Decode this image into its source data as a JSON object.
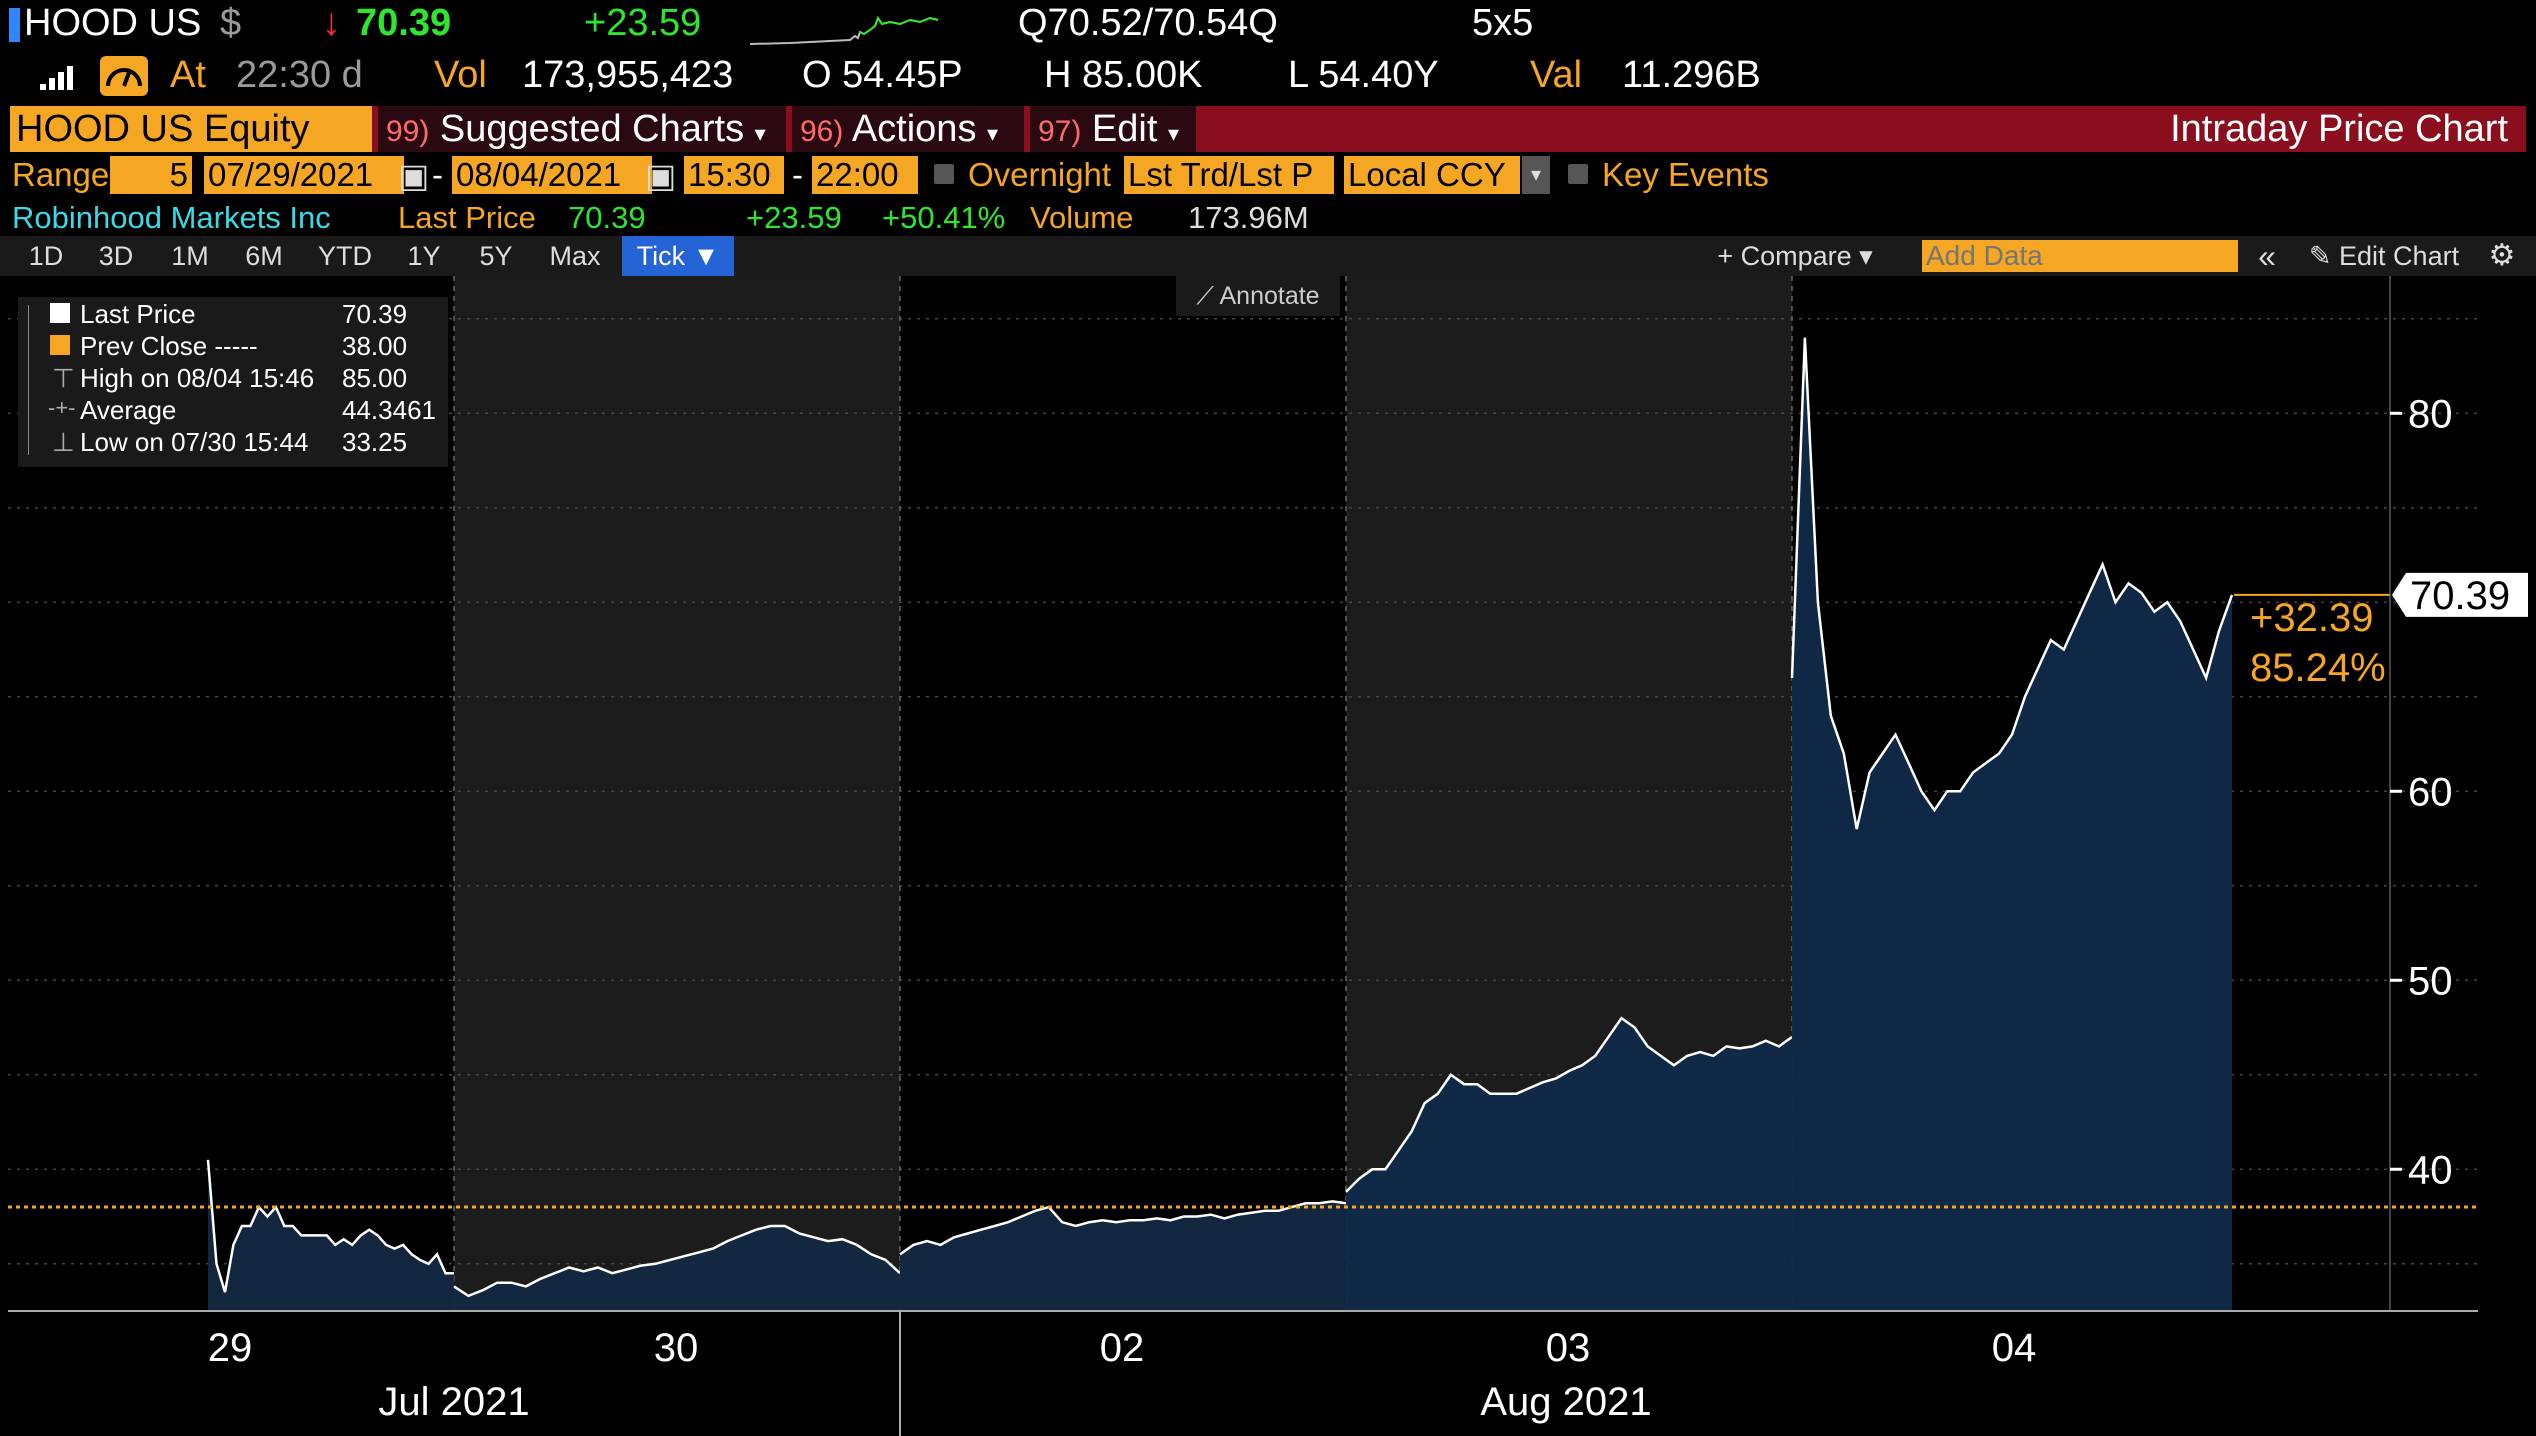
{
  "header": {
    "ticker": "HOOD US",
    "currency": "$",
    "arrow": "↓",
    "last": "70.39",
    "change": "+23.59",
    "quote": "Q70.52/70.54Q",
    "size": "5x5",
    "time_label": "At",
    "time": "22:30 d",
    "vol_label": "Vol",
    "vol": "173,955,423",
    "open": "O 54.45P",
    "high": "H 85.00K",
    "low": "L 54.40Y",
    "val_label": "Val",
    "val": "11.296B"
  },
  "menu": {
    "security": "HOOD US Equity",
    "suggested_num": "99)",
    "suggested": "Suggested Charts",
    "actions_num": "96)",
    "actions": "Actions",
    "edit_num": "97)",
    "edit": "Edit",
    "title": "Intraday Price Chart"
  },
  "range": {
    "label": "Range",
    "days": "5",
    "start": "07/29/2021",
    "end": "08/04/2021",
    "time_start": "15:30",
    "time_end": "22:00",
    "overnight": "Overnight",
    "lst_trd": "Lst Trd/Lst P",
    "ccy": "Local CCY",
    "key_events": "Key Events"
  },
  "info": {
    "name": "Robinhood Markets Inc",
    "last_label": "Last Price",
    "last": "70.39",
    "change": "+23.59",
    "pct": "+50.41%",
    "volume_label": "Volume",
    "volume": "173.96M"
  },
  "toolbar": {
    "periods": [
      "1D",
      "3D",
      "1M",
      "6M",
      "YTD",
      "1Y",
      "5Y",
      "Max"
    ],
    "tick": "Tick ▼",
    "compare": "+ Compare ▾",
    "add_data_placeholder": "Add Data",
    "collapse": "«",
    "edit_chart": "✎ Edit Chart",
    "settings_icon": "gear-icon",
    "annotate": "⟋ Annotate"
  },
  "chart_data": {
    "type": "area",
    "title": "Intraday Price Chart",
    "legend": [
      {
        "name": "Last Price",
        "value": "70.39"
      },
      {
        "name": "Prev Close -----",
        "value": "38.00"
      },
      {
        "name": "High on 08/04 15:46",
        "value": "85.00"
      },
      {
        "name": "Average",
        "value": "44.3461"
      },
      {
        "name": "Low on 07/30 15:44",
        "value": "33.25"
      }
    ],
    "ylim": [
      32.5,
      87
    ],
    "yticks": [
      40,
      50,
      60,
      80
    ],
    "ytick_labels": [
      "40",
      "50",
      "60",
      "80"
    ],
    "days": [
      "29",
      "30",
      "02",
      "03",
      "04"
    ],
    "months": [
      "Jul 2021",
      "Aug 2021"
    ],
    "prev_close": 38.0,
    "last_price": 70.39,
    "last_label": "70.39",
    "change_abs": "+32.39",
    "change_pct": "85.24%",
    "series": [
      {
        "day": 0,
        "values": [
          40.5,
          35,
          33.5,
          36,
          37,
          37,
          38,
          37.5,
          38,
          37,
          37,
          36.5,
          36.5,
          36.5,
          36.5,
          36,
          36.3,
          36,
          36.5,
          36.8,
          36.5,
          36,
          35.8,
          36,
          35.5,
          35.2,
          35,
          35.5,
          34.5,
          34.5
        ]
      },
      {
        "day": 1,
        "values": [
          33.8,
          33.3,
          33.6,
          34,
          34,
          33.8,
          34.2,
          34.5,
          34.8,
          34.6,
          34.8,
          34.5,
          34.7,
          34.9,
          35,
          35.2,
          35.4,
          35.6,
          35.8,
          36.2,
          36.5,
          36.8,
          37,
          37,
          36.6,
          36.4,
          36.2,
          36.3,
          36,
          35.5,
          35.2,
          34.5
        ]
      },
      {
        "day": 2,
        "values": [
          35.5,
          36,
          36.2,
          36,
          36.4,
          36.6,
          36.8,
          37,
          37.2,
          37.5,
          37.8,
          38,
          37.2,
          37,
          37.2,
          37.3,
          37.2,
          37.3,
          37.3,
          37.4,
          37.3,
          37.5,
          37.5,
          37.6,
          37.4,
          37.6,
          37.7,
          37.8,
          37.8,
          38,
          38.2,
          38.2,
          38.3,
          38.2
        ]
      },
      {
        "day": 3,
        "values": [
          38.8,
          39.5,
          40,
          40,
          41,
          42,
          43.5,
          44,
          45,
          44.5,
          44.5,
          44,
          44,
          44,
          44.3,
          44.6,
          44.8,
          45.2,
          45.5,
          46,
          47,
          48,
          47.5,
          46.5,
          46,
          45.5,
          46,
          46.2,
          46,
          46.5,
          46.4,
          46.5,
          46.8,
          46.5,
          47
        ]
      },
      {
        "day": 4,
        "values": [
          66,
          84,
          70,
          64,
          62,
          58,
          61,
          62,
          63,
          61.5,
          60,
          59,
          60,
          60,
          61,
          61.5,
          62,
          63,
          65,
          66.5,
          68,
          67.5,
          69,
          70.5,
          72,
          70,
          71,
          70.5,
          69.5,
          70,
          69,
          67.5,
          66,
          68.5,
          70.39
        ]
      }
    ]
  }
}
